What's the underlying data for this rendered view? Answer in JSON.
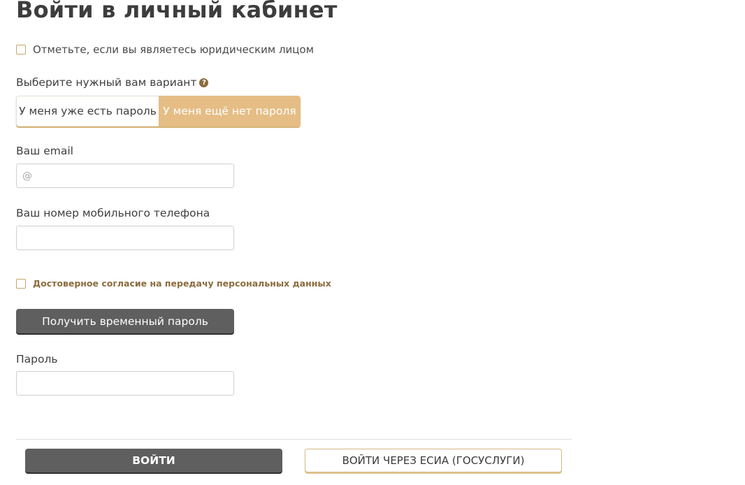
{
  "page": {
    "title": "Войти в личный кабинет"
  },
  "legal_entity": {
    "label": "Отметьте, если вы являетесь юридическим лицом",
    "checked": false
  },
  "variant": {
    "label": "Выберите нужный вам вариант",
    "help_icon": "question-circle-icon",
    "options": [
      {
        "label": "У меня уже есть пароль",
        "selected": false
      },
      {
        "label": "У меня ещё нет пароля",
        "selected": true
      }
    ]
  },
  "email": {
    "label": "Ваш email",
    "value": "",
    "placeholder": "@"
  },
  "phone": {
    "label": "Ваш номер мобильного телефона",
    "value": "",
    "placeholder": ""
  },
  "consent": {
    "label": "Достоверное согласие на передачу персональных данных",
    "checked": false
  },
  "temp_password_button": {
    "label": "Получить временный пароль"
  },
  "password": {
    "label": "Пароль",
    "value": "",
    "placeholder": ""
  },
  "footer": {
    "login_label": "ВОЙТИ",
    "esia_label": "ВОЙТИ ЧЕРЕЗ ЕСИА (ГОСУСЛУГИ)"
  },
  "colors": {
    "accent": "#e5bd85",
    "accent_dark": "#8b6c3e",
    "button_dark": "#5f5f5f"
  }
}
